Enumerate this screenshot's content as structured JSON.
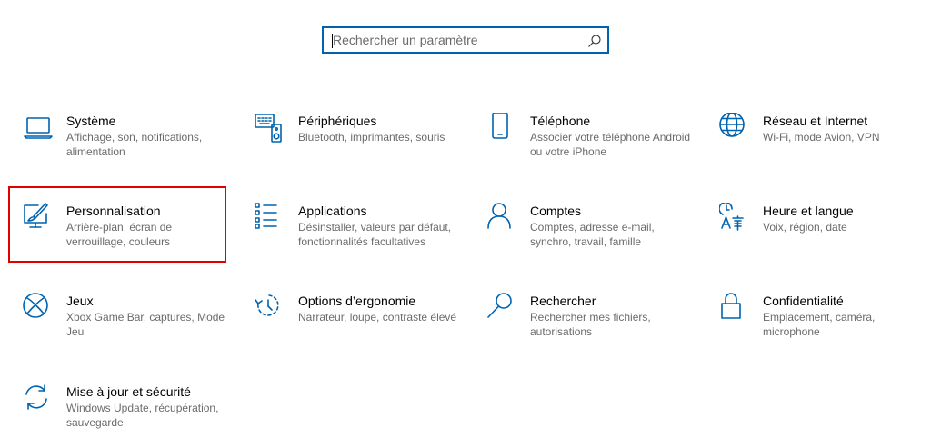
{
  "search": {
    "placeholder": "Rechercher un paramètre"
  },
  "tiles": [
    {
      "title": "Système",
      "desc": "Affichage, son, notifications, alimentation",
      "icon": "laptop-icon"
    },
    {
      "title": "Périphériques",
      "desc": "Bluetooth, imprimantes, souris",
      "icon": "keyboard-speaker-icon"
    },
    {
      "title": "Téléphone",
      "desc": "Associer votre téléphone Android ou votre iPhone",
      "icon": "phone-icon"
    },
    {
      "title": "Réseau et Internet",
      "desc": "Wi-Fi, mode Avion, VPN",
      "icon": "globe-icon"
    },
    {
      "title": "Personnalisation",
      "desc": "Arrière-plan, écran de verrouillage, couleurs",
      "icon": "paint-monitor-icon"
    },
    {
      "title": "Applications",
      "desc": "Désinstaller, valeurs par défaut, fonctionnalités facultatives",
      "icon": "apps-list-icon"
    },
    {
      "title": "Comptes",
      "desc": "Comptes, adresse e-mail, synchro, travail, famille",
      "icon": "person-icon"
    },
    {
      "title": "Heure et langue",
      "desc": "Voix, région, date",
      "icon": "time-language-icon"
    },
    {
      "title": "Jeux",
      "desc": "Xbox Game Bar, captures, Mode Jeu",
      "icon": "xbox-icon"
    },
    {
      "title": "Options d’ergonomie",
      "desc": "Narrateur, loupe, contraste élevé",
      "icon": "ease-of-access-icon"
    },
    {
      "title": "Rechercher",
      "desc": "Rechercher mes fichiers, autorisations",
      "icon": "search-icon"
    },
    {
      "title": "Confidentialité",
      "desc": "Emplacement, caméra, microphone",
      "icon": "lock-icon"
    },
    {
      "title": "Mise à jour et sécurité",
      "desc": "Windows Update, récupération, sauvegarde",
      "icon": "update-icon"
    }
  ],
  "colors": {
    "accent": "#0063b1",
    "highlight": "#e00000",
    "description": "#6b6b6b"
  }
}
